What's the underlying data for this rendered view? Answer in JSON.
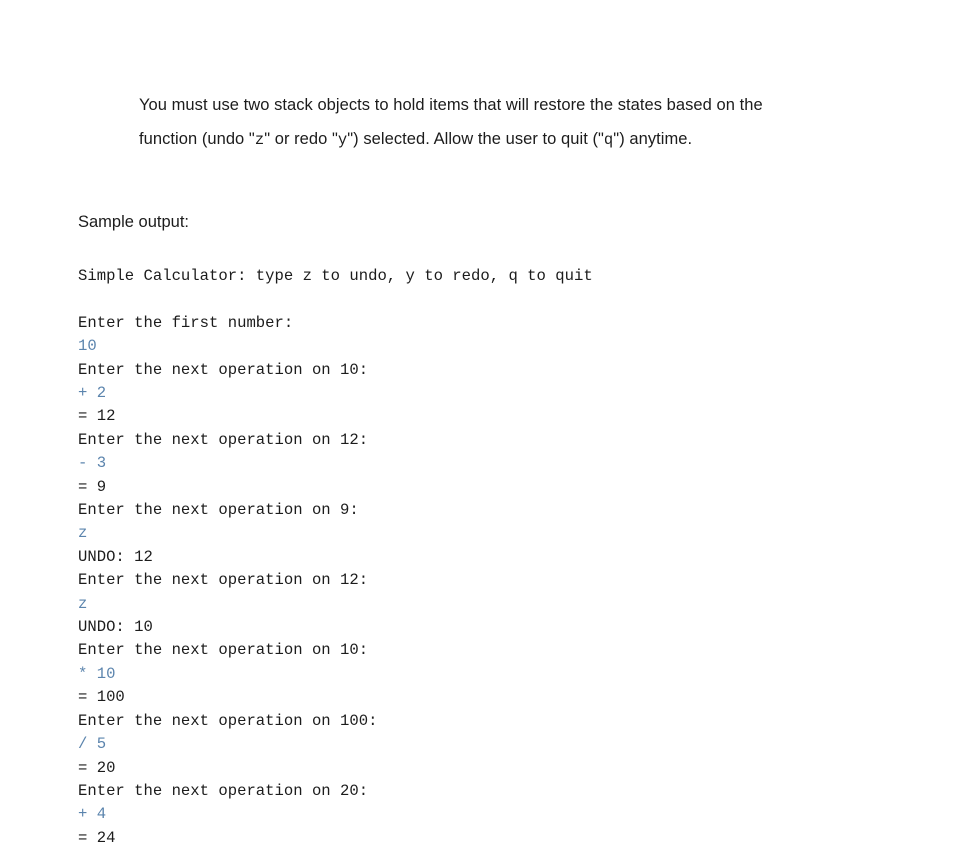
{
  "document": {
    "instruction": {
      "line1_part1": "You must use two stack objects to hold items that will restore the states based on the",
      "line2_part1": "function (undo \"",
      "line2_mono1": "z",
      "line2_part2": "\" or redo \"",
      "line2_mono2": "y",
      "line2_part3": "\") selected.   Allow the user to quit (\"",
      "line2_mono3": "q",
      "line2_part4": "\") anytime."
    },
    "sample_output_label": "Sample output:",
    "console": {
      "header": "Simple Calculator: type z to undo, y to redo, q to quit",
      "lines": [
        {
          "text": "Enter the first number:",
          "kind": "output"
        },
        {
          "text": "10",
          "kind": "input"
        },
        {
          "text": "Enter the next operation on 10:",
          "kind": "output"
        },
        {
          "text": "+ 2",
          "kind": "input"
        },
        {
          "text": "= 12",
          "kind": "output"
        },
        {
          "text": "Enter the next operation on 12:",
          "kind": "output"
        },
        {
          "text": "- 3",
          "kind": "input"
        },
        {
          "text": "= 9",
          "kind": "output"
        },
        {
          "text": "Enter the next operation on 9:",
          "kind": "output"
        },
        {
          "text": "z",
          "kind": "input"
        },
        {
          "text": "UNDO: 12",
          "kind": "output"
        },
        {
          "text": "Enter the next operation on 12:",
          "kind": "output"
        },
        {
          "text": "z",
          "kind": "input"
        },
        {
          "text": "UNDO: 10",
          "kind": "output"
        },
        {
          "text": "Enter the next operation on 10:",
          "kind": "output"
        },
        {
          "text": "* 10",
          "kind": "input"
        },
        {
          "text": "= 100",
          "kind": "output"
        },
        {
          "text": "Enter the next operation on 100:",
          "kind": "output"
        },
        {
          "text": "/ 5",
          "kind": "input"
        },
        {
          "text": "= 20",
          "kind": "output"
        },
        {
          "text": "Enter the next operation on 20:",
          "kind": "output"
        },
        {
          "text": "+ 4",
          "kind": "input"
        },
        {
          "text": "= 24",
          "kind": "output"
        }
      ]
    },
    "colors": {
      "text": "#1c1c1c",
      "user_input": "#5b84ad",
      "background": "#ffffff"
    }
  }
}
